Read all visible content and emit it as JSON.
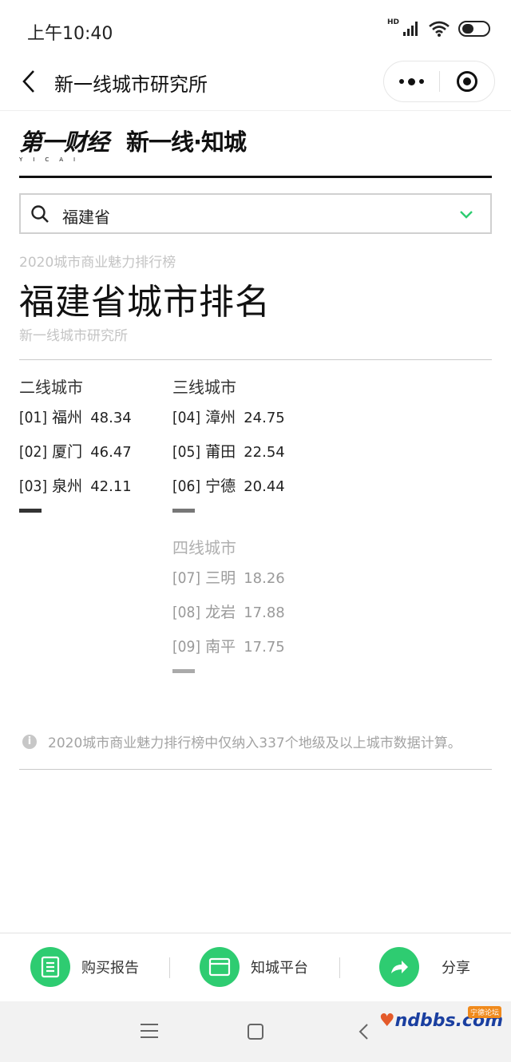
{
  "status_bar": {
    "time": "上午10:40",
    "hd_label": "HD",
    "icons": [
      "signal-icon",
      "wifi-icon",
      "battery-icon"
    ]
  },
  "nav": {
    "title": "新一线城市研究所",
    "icons": [
      "back-arrow-icon",
      "more-dots-icon",
      "target-icon"
    ]
  },
  "brand": {
    "logo_main": "第一财经",
    "logo_sub": "YICAI",
    "logo_second": "新一线·知城"
  },
  "selector": {
    "value": "福建省"
  },
  "heading": {
    "subtitle": "2020城市商业魅力排行榜",
    "title": "福建省城市排名",
    "source": "新一线城市研究所"
  },
  "tiers": [
    {
      "title": "二线城市",
      "cities": [
        {
          "rank": "[01]",
          "name": "福州",
          "score": "48.34"
        },
        {
          "rank": "[02]",
          "name": "厦门",
          "score": "46.47"
        },
        {
          "rank": "[03]",
          "name": "泉州",
          "score": "42.11"
        }
      ],
      "mark_color": "#333333"
    },
    {
      "title": "三线城市",
      "cities": [
        {
          "rank": "[04]",
          "name": "漳州",
          "score": "24.75"
        },
        {
          "rank": "[05]",
          "name": "莆田",
          "score": "22.54"
        },
        {
          "rank": "[06]",
          "name": "宁德",
          "score": "20.44"
        }
      ],
      "mark_color": "#777777"
    },
    {
      "title": "四线城市",
      "cities": [
        {
          "rank": "[07]",
          "name": "三明",
          "score": "18.26"
        },
        {
          "rank": "[08]",
          "name": "龙岩",
          "score": "17.88"
        },
        {
          "rank": "[09]",
          "name": "南平",
          "score": "17.75"
        }
      ],
      "mark_color": "#aaaaaa"
    }
  ],
  "note": {
    "text": "2020城市商业魅力排行榜中仅纳入337个地级及以上城市数据计算。"
  },
  "bottom_bar": {
    "buy_label": "购买报告",
    "platform_label": "知城平台",
    "share_label": "分享",
    "accent": "#2ecc71"
  },
  "watermark": {
    "main": "ndbbs.com",
    "tag": "宁德论坛"
  }
}
